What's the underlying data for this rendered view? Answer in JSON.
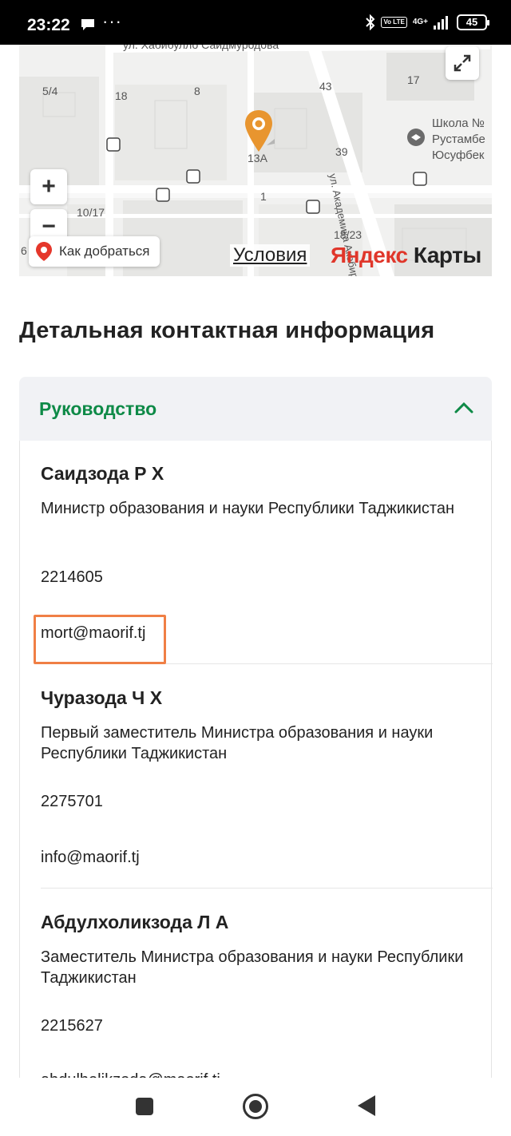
{
  "status_bar": {
    "time": "23:22",
    "dots": "···",
    "volte": "Vo LTE",
    "network": "4G+",
    "battery": "45"
  },
  "map": {
    "street_top": "ул. Хабибулло Саидмуродова",
    "street_right": "ул. Академика Акобиров",
    "school": "Школа №",
    "school_line2": "Рустамбе",
    "school_line3": "Юсуфбек",
    "numbers": [
      "5/4",
      "18",
      "8",
      "43",
      "13А",
      "39",
      "10/17",
      "1",
      "18/23",
      "17",
      "6"
    ],
    "route_button": "Как добраться",
    "terms": "Условия",
    "logo_part1": "Яндекс",
    "logo_part2": "Карты",
    "zoom_in": "+",
    "zoom_out": "−"
  },
  "section": {
    "title": "Детальная контактная информация"
  },
  "accordion": {
    "title": "Руководство",
    "people": [
      {
        "name": "Саидзода Р Х",
        "role": "Министр образования и науки Республики Таджикистан",
        "phone": "2214605",
        "email": "mort@maorif.tj"
      },
      {
        "name": "Чуразода Ч Х",
        "role": "Первый заместитель Министра образования и науки Республики Таджикистан",
        "phone": "2275701",
        "email": "info@maorif.tj"
      },
      {
        "name": "Абдулхоликзода Л А",
        "role": "Заместитель Министра образования и науки Республики Таджикистан",
        "phone": "2215627",
        "email": "abdulholikzoda@maorif.tj"
      }
    ]
  },
  "colors": {
    "accent_green": "#0e8a47",
    "highlight_orange": "#f07f45",
    "pin_orange": "#e8952f",
    "yandex_red": "#e0362a"
  }
}
